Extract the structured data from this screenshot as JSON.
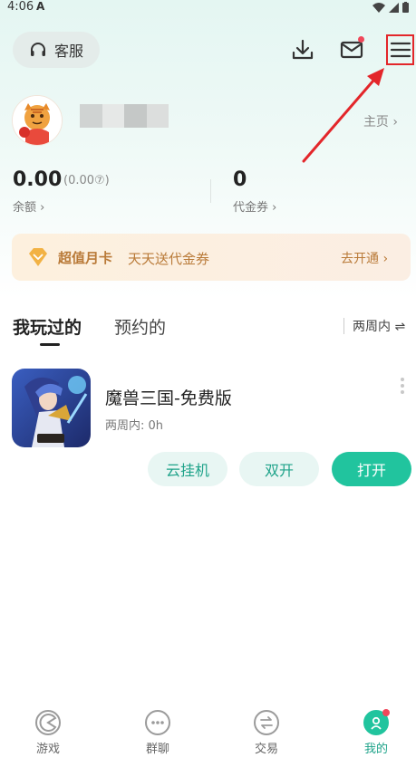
{
  "status_bar": {
    "time": "4:06",
    "app_glyph": "A",
    "icons": [
      "wifi-icon",
      "signal-icon",
      "battery-icon"
    ]
  },
  "header": {
    "customer_service_label": "客服",
    "icons": [
      "headset-icon",
      "download-icon",
      "mail-icon",
      "menu-icon"
    ]
  },
  "profile": {
    "home_link": "主页 ›"
  },
  "wallet": {
    "balance_value": "0.00",
    "balance_sub": "(0.00⑦)",
    "balance_label": "余额 ›",
    "voucher_value": "0",
    "voucher_label": "代金券 ›"
  },
  "promo": {
    "title": "超值月卡",
    "subtitle": "天天送代金券",
    "action": "去开通 ›"
  },
  "tabs": {
    "played": "我玩过的",
    "reserved": "预约的",
    "filter": "两周内 ⇌"
  },
  "game": {
    "title": "魔兽三国-免费版",
    "meta": "两周内: 0h",
    "buttons": {
      "cloud": "云挂机",
      "dual": "双开",
      "open": "打开"
    }
  },
  "bottom_nav": [
    {
      "label": "游戏",
      "icon": "pacman-icon",
      "active": false
    },
    {
      "label": "群聊",
      "icon": "chat-icon",
      "active": false
    },
    {
      "label": "交易",
      "icon": "exchange-icon",
      "active": false
    },
    {
      "label": "我的",
      "icon": "profile-icon",
      "active": true
    }
  ],
  "colors": {
    "accent": "#21c49e",
    "accent_text": "#1fa38a",
    "promo_text": "#b97a38",
    "annotation_red": "#e3262a",
    "badge_red": "#f0475a"
  }
}
